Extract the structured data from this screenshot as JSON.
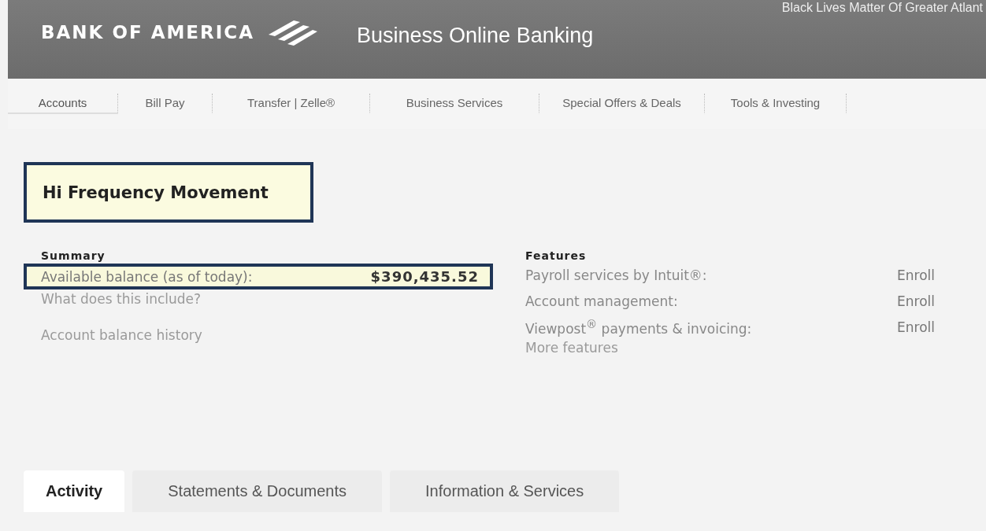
{
  "header": {
    "logo": "BANK OF AMERICA",
    "product": "Business Online Banking",
    "top_note": "Black Lives Matter Of Greater Atlant"
  },
  "nav": [
    {
      "label": "Accounts",
      "selected": true
    },
    {
      "label": "Bill Pay",
      "selected": false
    },
    {
      "label": "Transfer | Zelle®",
      "selected": false
    },
    {
      "label": "Business Services",
      "selected": false
    },
    {
      "label": "Special Offers & Deals",
      "selected": false
    },
    {
      "label": "Tools & Investing",
      "selected": false
    }
  ],
  "account": {
    "title": "Hi Frequency Movement",
    "highlighted": true
  },
  "summary": {
    "heading": "Summary",
    "balance_label": "Available balance (as of today):",
    "balance": "$390,435.52",
    "highlighted": true,
    "links": [
      "What does this include?",
      "Account balance history"
    ]
  },
  "features": {
    "heading": "Features",
    "rows": [
      {
        "label": "Payroll services by Intuit®:",
        "action": "Enroll"
      },
      {
        "label": "Account management:",
        "action": "Enroll"
      },
      {
        "label": "Viewpost$^{®}$ payments & invoicing:",
        "action": "Enroll"
      }
    ],
    "more": "More features"
  },
  "tabs": [
    {
      "label": "Activity",
      "selected": true
    },
    {
      "label": "Statements & Documents",
      "selected": false
    },
    {
      "label": "Information & Services",
      "selected": false
    }
  ]
}
